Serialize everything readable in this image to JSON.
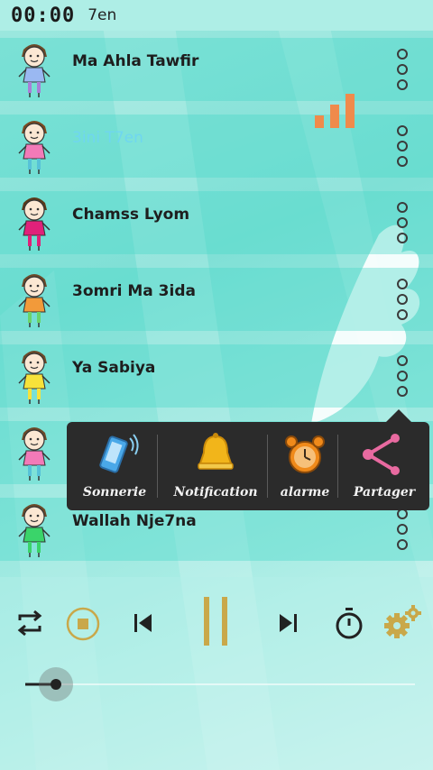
{
  "status": {
    "timer": "00:00",
    "current_song": "7en"
  },
  "songs": [
    {
      "title": "Ma Ahla Tawfir",
      "playing": false,
      "shirt": "#9ab8f2",
      "hair": "#6b4a2a",
      "legs": "#a87fd8"
    },
    {
      "title": "3ini T7en",
      "playing": true,
      "shirt": "#f27ab8",
      "hair": "#7a4a22",
      "legs": "#57c2d8"
    },
    {
      "title": "Chamss Lyom",
      "playing": false,
      "shirt": "#e0217a",
      "hair": "#5a3a1a",
      "legs": "#e0217a"
    },
    {
      "title": "3omri Ma 3ida",
      "playing": false,
      "shirt": "#f29a3a",
      "hair": "#6b4a2a",
      "legs": "#6ad46a"
    },
    {
      "title": "Ya Sabiya",
      "playing": false,
      "shirt": "#f7e23a",
      "hair": "#6b4a2a",
      "legs": "#f7e23a"
    },
    {
      "title": "",
      "playing": false,
      "shirt": "#f27ab8",
      "hair": "#6b4a2a",
      "legs": "#57c2d8"
    },
    {
      "title": "Wallah Nje7na",
      "playing": false,
      "shirt": "#3ad46a",
      "hair": "#6b4a2a",
      "legs": "#3ad46a"
    }
  ],
  "context_menu": {
    "items": [
      {
        "label": "Sonnerie",
        "icon": "phone-ringtone-icon"
      },
      {
        "label": "Notification",
        "icon": "bell-icon"
      },
      {
        "label": "alarme",
        "icon": "alarm-clock-icon"
      },
      {
        "label": "Partager",
        "icon": "share-icon"
      }
    ]
  },
  "player": {
    "buttons": [
      "repeat-icon",
      "stop-icon",
      "previous-icon",
      "pause-icon",
      "next-icon",
      "timer-icon",
      "settings-icon"
    ],
    "accent": "#c9a84a",
    "progress": 0
  },
  "colors": {
    "accent_orange": "#f08a4b",
    "playing_title": "#6fd6f0"
  }
}
